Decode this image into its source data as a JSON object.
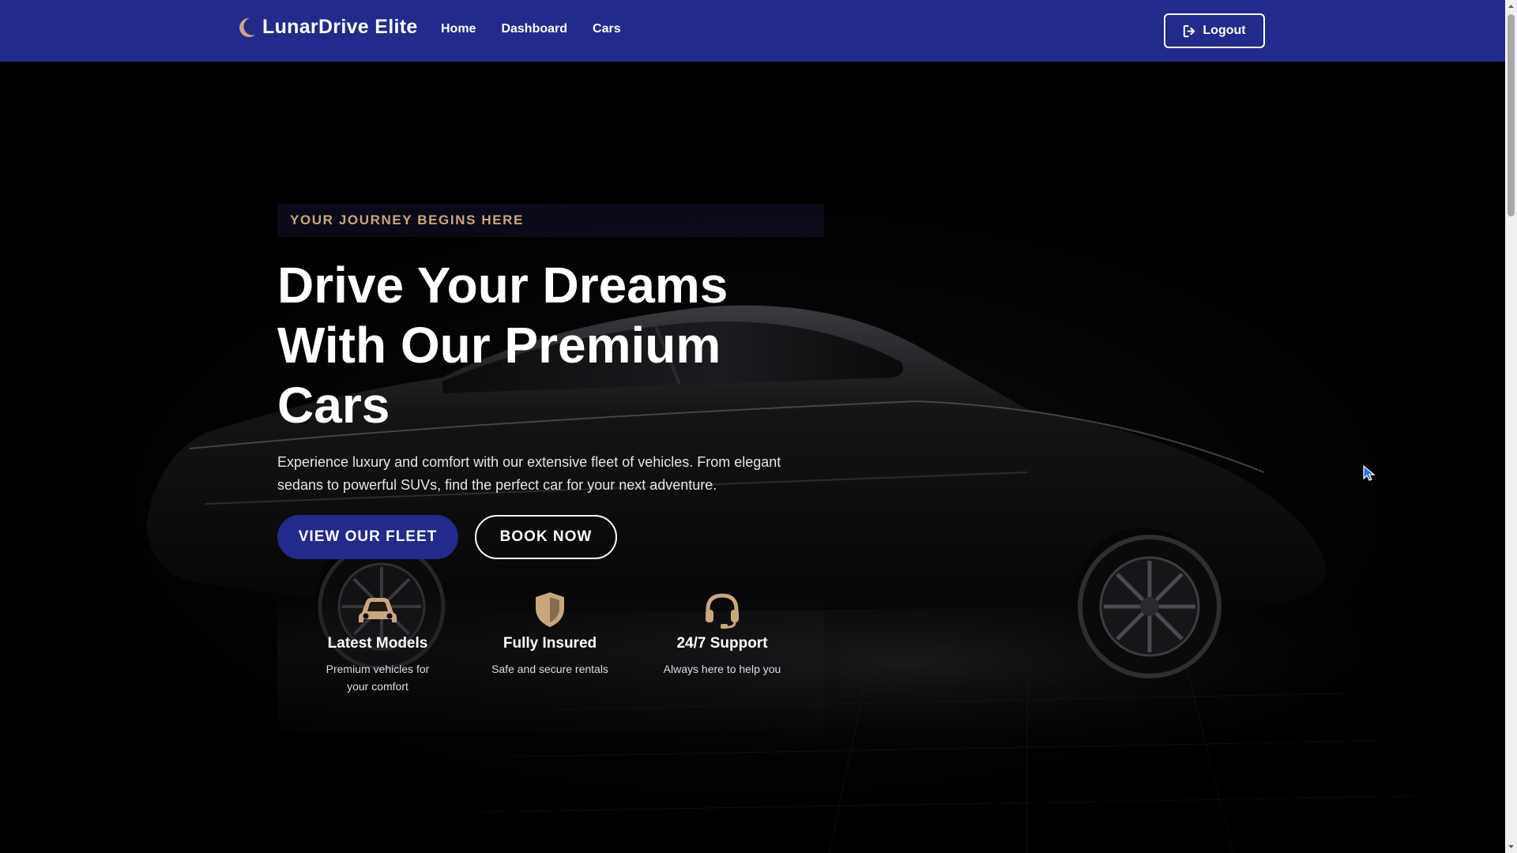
{
  "navbar": {
    "brand_icon": "crescent-moon-icon",
    "brand_name": "LunarDrive Elite",
    "links": [
      "Home",
      "Dashboard",
      "Cars"
    ],
    "logout_icon": "sign-out-icon",
    "logout_label": "Logout"
  },
  "hero": {
    "tagline": "YOUR JOURNEY BEGINS HERE",
    "headline": "Drive Your Dreams With Our Premium Cars",
    "description": "Experience luxury and comfort with our extensive fleet of vehicles. From elegant sedans to powerful SUVs, find the perfect car for your next adventure.",
    "primary_button": "VIEW OUR FLEET",
    "secondary_button": "BOOK NOW",
    "background_image": "dark-luxury-sedan-photo"
  },
  "features": [
    {
      "icon": "car-icon",
      "title": "Latest Models",
      "description": "Premium vehicles for your comfort"
    },
    {
      "icon": "shield-icon",
      "title": "Fully Insured",
      "description": "Safe and secure rentals"
    },
    {
      "icon": "headset-icon",
      "title": "24/7 Support",
      "description": "Always here to help you"
    }
  ],
  "colors": {
    "navbar_bg": "#222a8c",
    "accent_gold": "#c9a77e",
    "primary_button_bg": "#222a8c",
    "hero_bg": "#000000"
  }
}
